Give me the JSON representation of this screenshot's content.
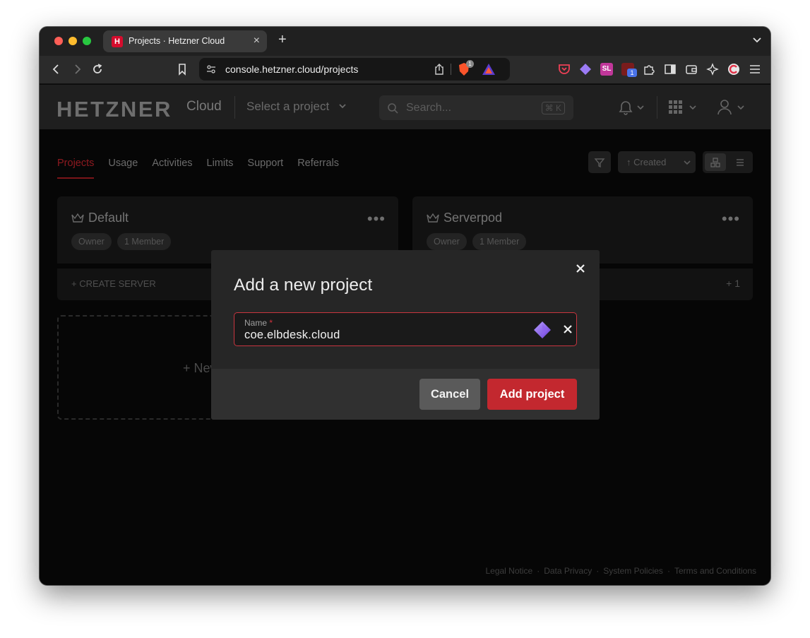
{
  "browser": {
    "tab_title": "Projects · Hetzner Cloud",
    "favicon_letter": "H",
    "url": "console.hetzner.cloud/projects",
    "brave_badge": "1",
    "ext_badge": "1",
    "sl_label": "SL"
  },
  "header": {
    "logo": "HETZNER",
    "logo_suffix": "Cloud",
    "project_select": "Select a project",
    "search_placeholder": "Search...",
    "search_shortcut": "⌘ K"
  },
  "nav": {
    "tabs": [
      {
        "label": "Projects",
        "active": true
      },
      {
        "label": "Usage"
      },
      {
        "label": "Activities"
      },
      {
        "label": "Limits"
      },
      {
        "label": "Support"
      },
      {
        "label": "Referrals"
      }
    ]
  },
  "controls": {
    "sort_label": "↑ Created"
  },
  "projects": [
    {
      "name": "Default",
      "role": "Owner",
      "members": "1 Member",
      "action": "+ CREATE SERVER"
    },
    {
      "name": "Serverpod",
      "role": "Owner",
      "members": "1 Member",
      "extra": "+ 1"
    }
  ],
  "new_project_label": "+ New",
  "footer": {
    "links": [
      "Legal Notice",
      "Data Privacy",
      "System Policies",
      "Terms and Conditions"
    ]
  },
  "modal": {
    "title": "Add a new project",
    "field_label": "Name",
    "field_required_mark": "*",
    "field_value": "coe.elbdesk.cloud",
    "cancel_label": "Cancel",
    "submit_label": "Add project"
  },
  "colors": {
    "accent": "#c3282f",
    "field_border": "#c8353f"
  }
}
